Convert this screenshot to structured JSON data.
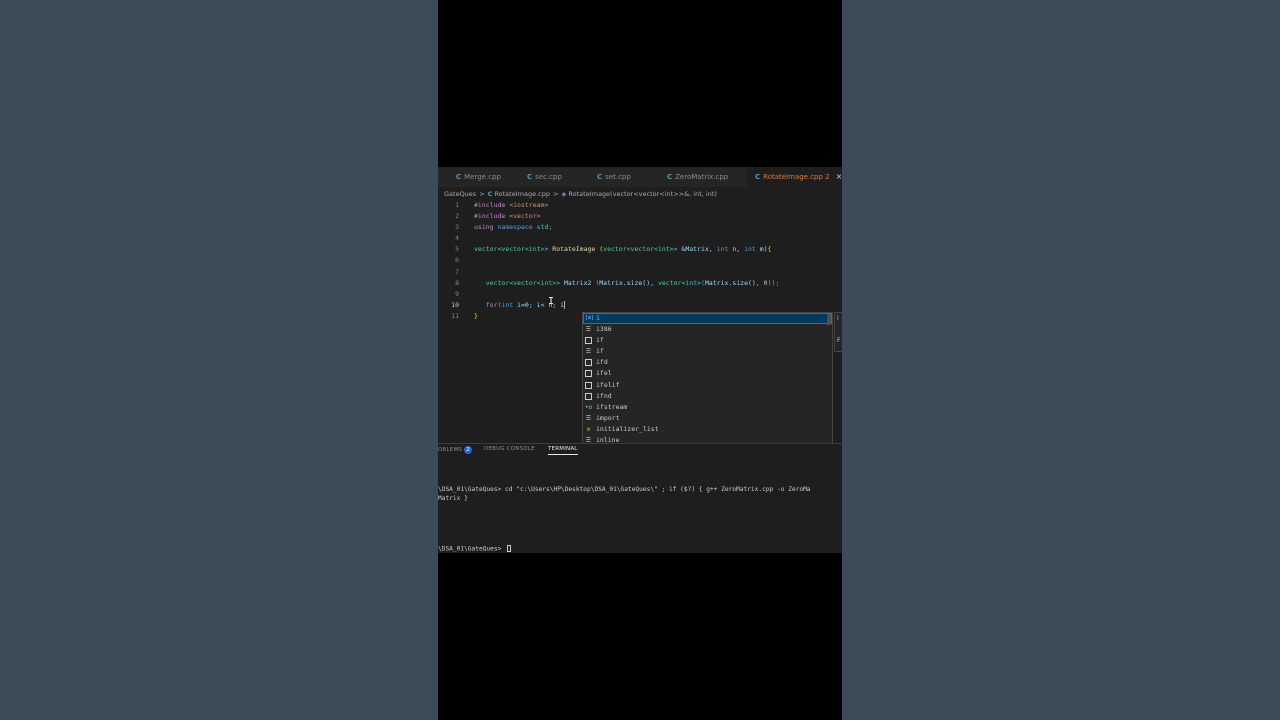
{
  "tabs": [
    {
      "label": "Merge.cpp",
      "active": false
    },
    {
      "label": "sec.cpp",
      "active": false
    },
    {
      "label": "set.cpp",
      "active": false
    },
    {
      "label": "ZeroMatrix.cpp",
      "active": false
    },
    {
      "label": "RotateImage.cpp 2",
      "active": true
    }
  ],
  "file_icon_glyph": "C",
  "close_glyph": "×",
  "breadcrumb": {
    "folder": "GateQues",
    "file": "RotateImage.cpp",
    "symbol": "RotateImage(vector<vector<int>>&, int, int)",
    "separator": ">"
  },
  "code": {
    "line_numbers": [
      "1",
      "2",
      "3",
      "4",
      "5",
      "6",
      "7",
      "8",
      "9",
      "10",
      "11"
    ],
    "l1_kw": "#include",
    "l1_hdr": "<iostream>",
    "l2_kw": "#include",
    "l2_hdr": "<vector>",
    "l3_using": "using",
    "l3_ns": "namespace",
    "l3_std": "std;",
    "l5_vector": "vector<vector<int>>",
    "l5_fn": "RotateImage",
    "l5_params_open": " (",
    "l5_ptype": "vector<vector<int>>",
    "l5_ref": " &Matrix, ",
    "l5_int1": "int",
    "l5_n": " n, ",
    "l5_int2": "int",
    "l5_m": " m",
    "l5_close": "){",
    "l8_type": "vector<vector<int>>",
    "l8_var": " Matrix2 ",
    "l8_open": "(",
    "l8_m1": "Matrix.size()",
    "l8_comma": ", ",
    "l8_vec": "vector<int>",
    "l8_p": "(",
    "l8_m2": "Matrix.size()",
    "l8_zero": ", 0",
    "l8_end": "));",
    "l10_for": "for",
    "l10_open": "(",
    "l10_int": "int",
    "l10_i": " i=0; ",
    "l10_lt": "i< n; ",
    "l10_typed": "i",
    "l11_close": "}"
  },
  "suggestions": [
    {
      "label": "i",
      "icon": "variable",
      "selected": true
    },
    {
      "label": "i386",
      "icon": "keyword",
      "selected": false
    },
    {
      "label": "if",
      "icon": "snippet",
      "selected": false
    },
    {
      "label": "if",
      "icon": "keyword",
      "selected": false
    },
    {
      "label": "ifd",
      "icon": "snippet",
      "selected": false
    },
    {
      "label": "ifel",
      "icon": "snippet",
      "selected": false
    },
    {
      "label": "ifelif",
      "icon": "snippet",
      "selected": false
    },
    {
      "label": "ifnd",
      "icon": "snippet",
      "selected": false
    },
    {
      "label": "ifstream",
      "icon": "module",
      "selected": false
    },
    {
      "label": "import",
      "icon": "keyword",
      "selected": false
    },
    {
      "label": "initializer_list",
      "icon": "class",
      "selected": false
    },
    {
      "label": "inline",
      "icon": "keyword",
      "selected": false
    }
  ],
  "panel": {
    "problems_label": "OBLEMS",
    "problems_count": "2",
    "debug_label": "DEBUG CONSOLE",
    "terminal_label": "TERMINAL",
    "terminal_lines": [
      "\\DSA_01\\GateQues> cd \"c:\\Users\\HP\\Desktop\\DSA_01\\GateQues\\\" ; if ($?) { g++ ZeroMatrix.cpp -o ZeroMa",
      "Matrix }",
      "\\DSA_01\\GateQues> "
    ]
  },
  "colors": {
    "editor_bg": "#1e1e1e",
    "active_tab_text": "#e37933",
    "selection_blue": "#04395e",
    "highlight": "#18a3ff"
  }
}
